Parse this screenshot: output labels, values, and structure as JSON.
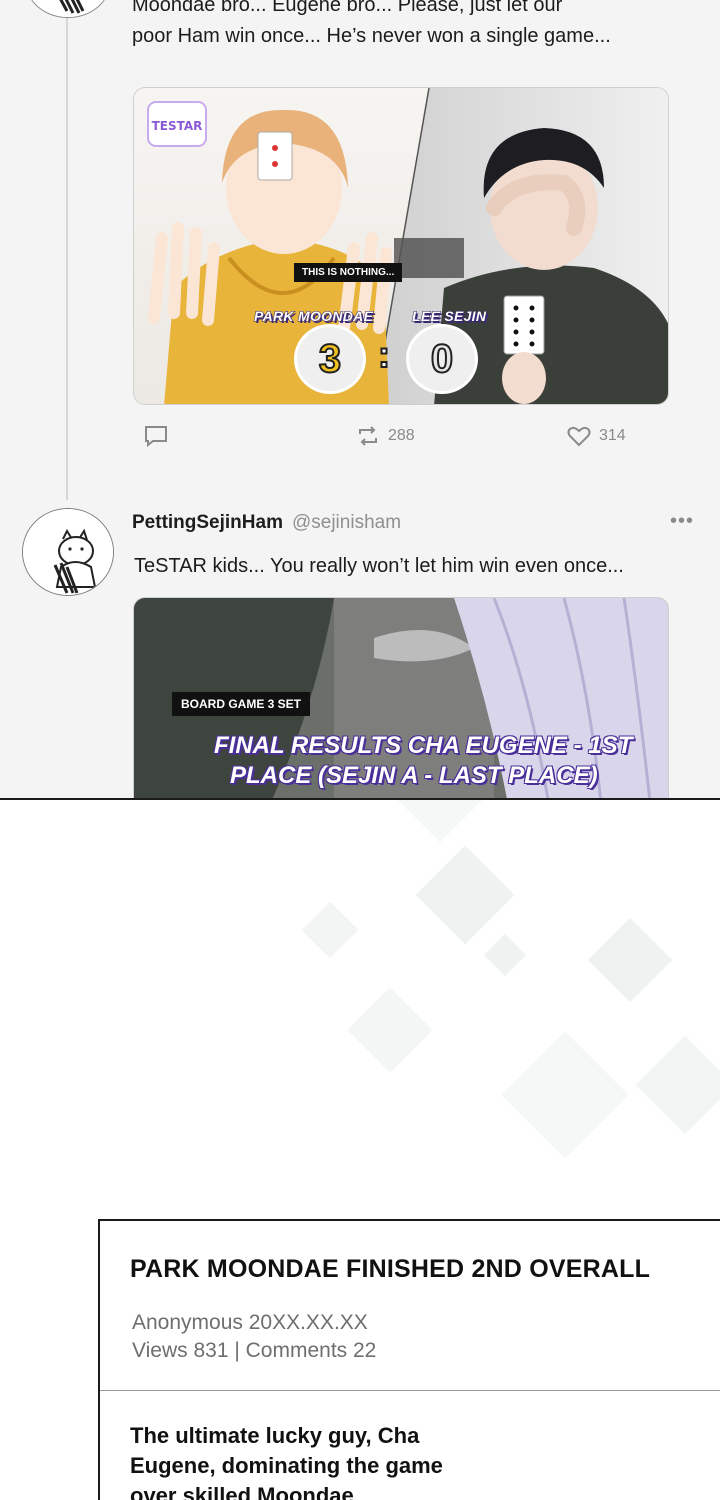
{
  "feed": {
    "tweet1": {
      "text_line1": "Moondae bro... Eugene bro... Please, just let our",
      "text_line2": "poor Ham win once... He’s never won a single game...",
      "image": {
        "logo": "TESTAR",
        "caption": "THIS IS NOTHING...",
        "player1": "PARK MOONDAE",
        "player2": "LEE SEJIN",
        "score1": "3",
        "score_sep": ":",
        "score2": "0"
      },
      "actions": {
        "reply_icon": "reply-bubble-icon",
        "retweet_icon": "retweet-icon",
        "retweet_count": "288",
        "like_icon": "heart-icon",
        "like_count": "314"
      }
    },
    "tweet2": {
      "username": "PettingSejinHam",
      "handle": "@sejinisham",
      "more": "•••",
      "text": "TeSTAR kids... You really won’t let him win even once...",
      "image": {
        "caption": "BOARD GAME 3 SET",
        "line1": "FINAL RESULTS CHA EUGENE - 1ST",
        "line2": "PLACE (SEJIN A - LAST PLACE)"
      }
    }
  },
  "post": {
    "title": "PARK MOONDAE FINISHED 2ND OVERALL",
    "author_date": "Anonymous 20XX.XX.XX",
    "stats": "Views 831 | Comments 22",
    "body_line1": "The ultimate lucky guy, Cha",
    "body_line2": "Eugene, dominating the game",
    "body_line3": "over skilled Moondae"
  },
  "colors": {
    "feed_bg": "#f4f4f4",
    "icon_gray": "#8a8a8a",
    "hoodie_yellow": "#e8b43a",
    "caption_purple": "#4a2f9a"
  }
}
